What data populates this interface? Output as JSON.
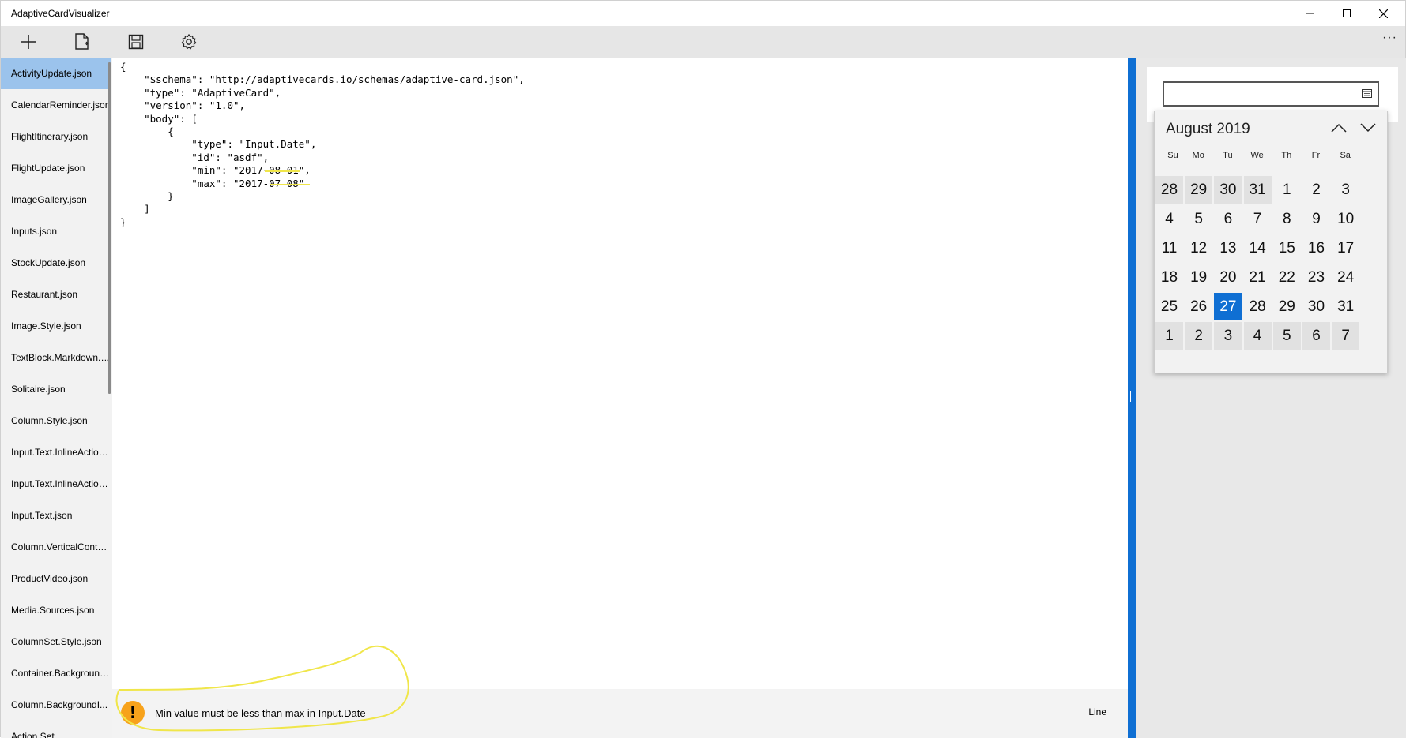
{
  "window": {
    "title": "AdaptiveCardVisualizer"
  },
  "toolbar": {
    "more_label": "···"
  },
  "icons": {
    "new": "plus-icon",
    "open": "document-icon",
    "save": "save-icon",
    "settings": "gear-icon"
  },
  "sidebar": {
    "items": [
      "ActivityUpdate.json",
      "CalendarReminder.json",
      "FlightItinerary.json",
      "FlightUpdate.json",
      "ImageGallery.json",
      "Inputs.json",
      "StockUpdate.json",
      "Restaurant.json",
      "Image.Style.json",
      "TextBlock.Markdown.json",
      "Solitaire.json",
      "Column.Style.json",
      "Input.Text.InlineAction...",
      "Input.Text.InlineAction...",
      "Input.Text.json",
      "Column.VerticalConte...",
      "ProductVideo.json",
      "Media.Sources.json",
      "ColumnSet.Style.json",
      "Container.Background...",
      "Column.BackgroundI...",
      "Action.Set..."
    ],
    "selected_index": 0
  },
  "editor": {
    "code": "{\n    \"$schema\": \"http://adaptivecards.io/schemas/adaptive-card.json\",\n    \"type\": \"AdaptiveCard\",\n    \"version\": \"1.0\",\n    \"body\": [\n        {\n            \"type\": \"Input.Date\",\n            \"id\": \"asdf\",\n            \"min\": \"2017-08-01\",\n            \"max\": \"2017-07-08\"\n        }\n    ]\n}"
  },
  "status": {
    "icon_glyph": "!",
    "message": "Min value must be less than max in Input.Date",
    "line_label": "Line"
  },
  "calendar": {
    "month_label": "August 2019",
    "day_names": [
      "Su",
      "Mo",
      "Tu",
      "We",
      "Th",
      "Fr",
      "Sa"
    ],
    "weeks": [
      [
        "28",
        "29",
        "30",
        "31",
        "1",
        "2",
        "3"
      ],
      [
        "4",
        "5",
        "6",
        "7",
        "8",
        "9",
        "10"
      ],
      [
        "11",
        "12",
        "13",
        "14",
        "15",
        "16",
        "17"
      ],
      [
        "18",
        "19",
        "20",
        "21",
        "22",
        "23",
        "24"
      ],
      [
        "25",
        "26",
        "27",
        "28",
        "29",
        "30",
        "31"
      ],
      [
        "1",
        "2",
        "3",
        "4",
        "5",
        "6",
        "7"
      ]
    ],
    "today": "27"
  },
  "colors": {
    "accent": "#0f6fd3",
    "selection": "#9bc3ec",
    "warning": "#f7a21b",
    "annotation": "#f0e64a"
  }
}
